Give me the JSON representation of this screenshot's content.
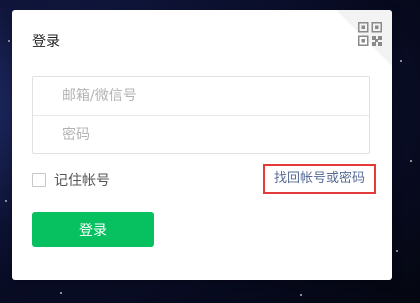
{
  "header": {
    "title": "登录"
  },
  "form": {
    "account_placeholder": "邮箱/微信号",
    "password_placeholder": "密码",
    "remember_label": "记住帐号",
    "forgot_link": "找回帐号或密码",
    "login_button": "登录"
  },
  "icons": {
    "qr_code": "qr-code-icon"
  },
  "colors": {
    "primary": "#07c160",
    "link": "#576b95",
    "highlight_border": "#e33a3a"
  }
}
